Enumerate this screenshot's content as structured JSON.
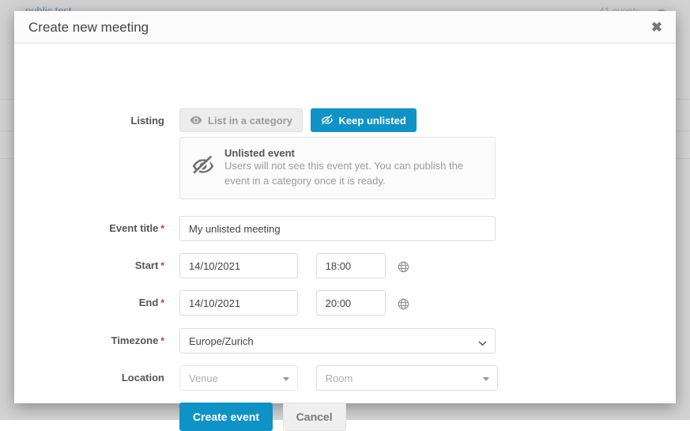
{
  "background": {
    "page_title": "public test",
    "events_count": "41 events",
    "arrow_icon": "arrow-right-icon"
  },
  "modal": {
    "title": "Create new meeting",
    "close_label": "✖",
    "listing": {
      "label": "Listing",
      "options": [
        {
          "label": "List in a category",
          "icon": "eye-icon",
          "active": false
        },
        {
          "label": "Keep unlisted",
          "icon": "eye-slash-icon",
          "active": true
        }
      ]
    },
    "notice": {
      "icon": "eye-slash-icon",
      "title": "Unlisted event",
      "description": "Users will not see this event yet. You can publish the event in a category once it is ready."
    },
    "fields": {
      "event_title": {
        "label": "Event title",
        "required": "*",
        "value": "My unlisted meeting",
        "placeholder": ""
      },
      "start": {
        "label": "Start",
        "required": "*",
        "date": "14/10/2021",
        "time": "18:00",
        "timezone_icon": "globe-icon"
      },
      "end": {
        "label": "End",
        "required": "*",
        "date": "14/10/2021",
        "time": "20:00",
        "timezone_icon": "globe-icon"
      },
      "timezone": {
        "label": "Timezone",
        "required": "*",
        "value": "Europe/Zurich"
      },
      "location": {
        "label": "Location",
        "venue_placeholder": "Venue",
        "room_placeholder": "Room"
      }
    },
    "actions": {
      "submit": "Create event",
      "cancel": "Cancel"
    }
  },
  "colors": {
    "accent": "#0f93c6",
    "required": "#c9302c",
    "muted": "#9b9b9b"
  }
}
